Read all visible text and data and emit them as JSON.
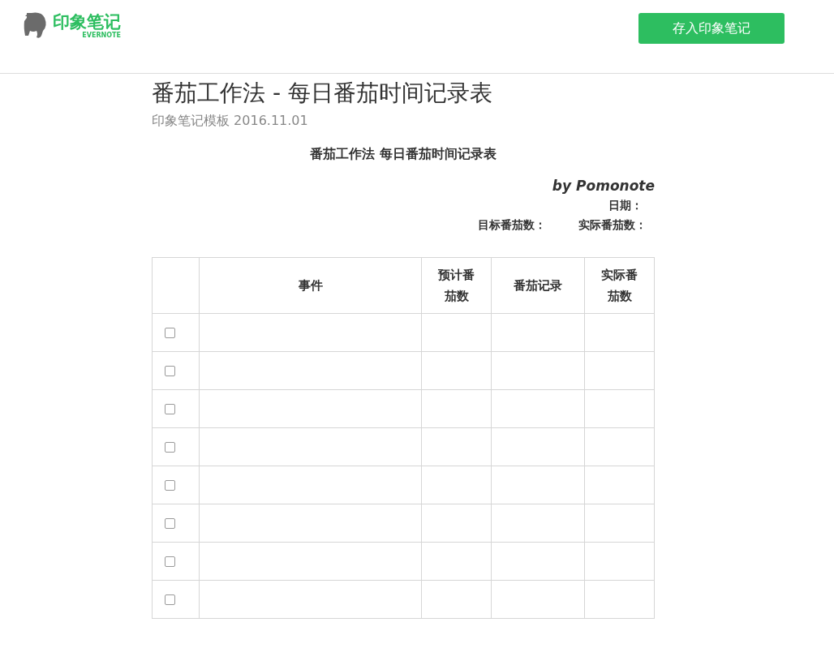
{
  "header": {
    "logo_text": "印象笔记",
    "logo_subtext": "EVERNOTE",
    "save_button": "存入印象笔记"
  },
  "note": {
    "title": "番茄工作法 - 每日番茄时间记录表",
    "subtitle": "印象笔记模板 2016.11.01"
  },
  "content": {
    "heading": "番茄工作法 每日番茄时间记录表",
    "byline": "by Pomonote",
    "date_label": "日期：",
    "target_label": "目标番茄数：",
    "actual_label": "实际番茄数："
  },
  "table": {
    "columns": [
      "",
      "事件",
      "预计番茄数",
      "番茄记录",
      "实际番茄数"
    ],
    "rows": [
      {
        "checked": false
      },
      {
        "checked": false
      },
      {
        "checked": false
      },
      {
        "checked": false
      },
      {
        "checked": false
      },
      {
        "checked": false
      },
      {
        "checked": false
      },
      {
        "checked": false
      }
    ]
  }
}
